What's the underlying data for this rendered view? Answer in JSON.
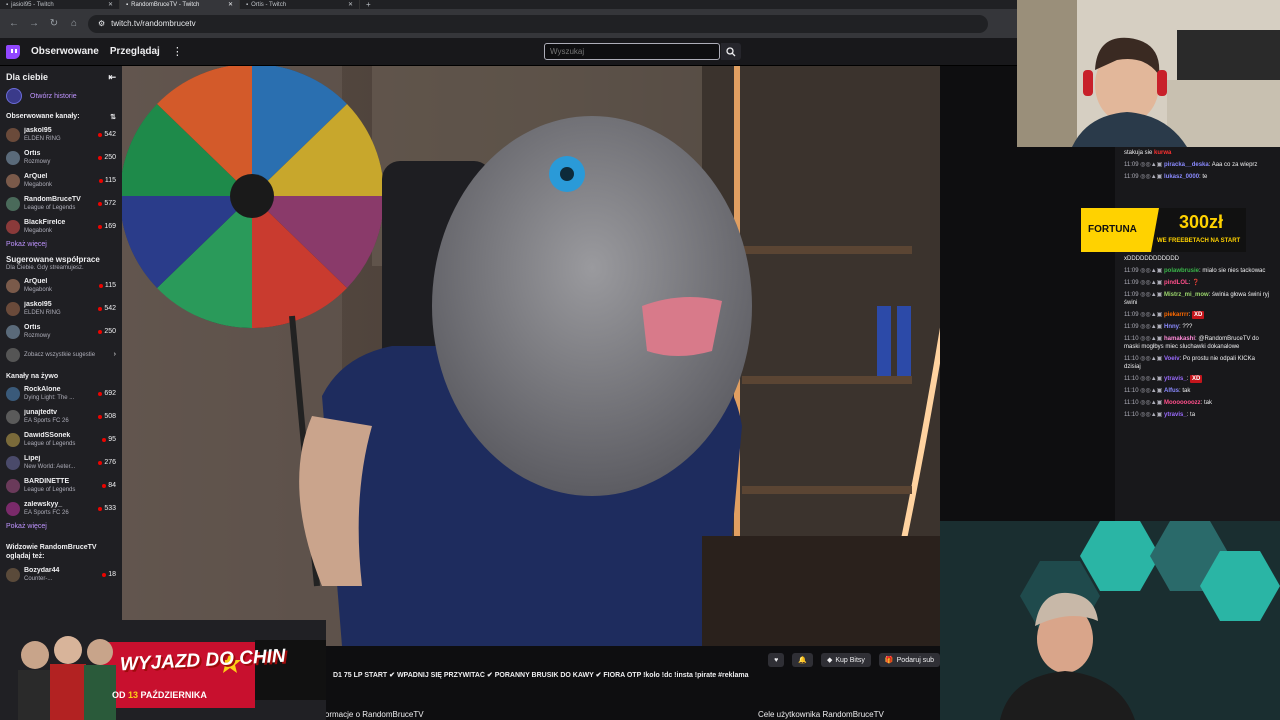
{
  "browser": {
    "tabs": [
      {
        "title": "jasiol95 - Twitch",
        "active": false
      },
      {
        "title": "RandomBruceTV - Twitch",
        "active": true
      },
      {
        "title": "Ortis - Twitch",
        "active": false
      }
    ],
    "new_tab": "+",
    "url": "twitch.tv/randombrucetv"
  },
  "topnav": {
    "followed": "Obserwowane",
    "browse": "Przeglądaj",
    "search_placeholder": "Wyszukaj"
  },
  "sidebar": {
    "title": "Dla ciebie",
    "history": "Otwórz historie",
    "followed_title": "Obserwowane kanały:",
    "followed": [
      {
        "name": "jaskol95",
        "game": "ELDEN RING",
        "viewers": "542",
        "color": "#6a4a3a"
      },
      {
        "name": "Ortis",
        "game": "Rozmowy",
        "viewers": "250",
        "color": "#5a6a7a"
      },
      {
        "name": "ArQuel",
        "game": "Megabonk",
        "viewers": "115",
        "color": "#7a5a4a"
      },
      {
        "name": "RandomBruceTV",
        "game": "League of Legends",
        "viewers": "572",
        "color": "#4a6a5a"
      },
      {
        "name": "BlackFireIce",
        "game": "Megabonk",
        "viewers": "169",
        "color": "#8a3a3a"
      }
    ],
    "show_more_1": "Pokaż więcej",
    "suggested_title": "Sugerowane współprace",
    "suggested_sub": "Dla Ciebie. Gdy streamujesz.",
    "suggested": [
      {
        "name": "ArQuel",
        "game": "Megabonk",
        "viewers": "115",
        "color": "#7a5a4a"
      },
      {
        "name": "jaskol95",
        "game": "ELDEN RING",
        "viewers": "542",
        "color": "#6a4a3a"
      },
      {
        "name": "Ortis",
        "game": "Rozmowy",
        "viewers": "250",
        "color": "#5a6a7a"
      }
    ],
    "see_all": "Zobacz wszystkie sugestie",
    "live_title": "Kanały na żywo",
    "live": [
      {
        "name": "RockAlone",
        "game": "Dying Light: The ...",
        "viewers": "692",
        "color": "#3a5a7a"
      },
      {
        "name": "junajtedtv",
        "game": "EA Sports FC 26",
        "viewers": "508",
        "color": "#5a5a5a"
      },
      {
        "name": "DawidSSonek",
        "game": "League of Legends",
        "viewers": "95",
        "color": "#7a6a3a"
      },
      {
        "name": "Lipej",
        "game": "New World: Aeter...",
        "viewers": "276",
        "color": "#4a4a6a"
      },
      {
        "name": "BARDINETTE",
        "game": "League of Legends",
        "viewers": "84",
        "color": "#6a3a5a"
      },
      {
        "name": "zalewskyy_",
        "game": "EA Sports FC 26",
        "viewers": "533",
        "color": "#7a2a6a"
      }
    ],
    "show_more_2": "Pokaż więcej",
    "watched_title": "Widzowie RandomBruceTV oglądaj też:",
    "watched": [
      {
        "name": "Bozydar44",
        "game": "Counter-...",
        "viewers": "18",
        "color": "#5a4a3a"
      }
    ]
  },
  "player_bar": {
    "buy_bits": "Kup Bitsy",
    "gift_sub": "Podaruj sub"
  },
  "stream_title": "D1 75 LP START ✔ WPADNIJ SIĘ PRZYWITAĆ ✔ PORANNY BRUSIK DO KAWY ✔ FIORA OTP !kolo !dc !insta !pirate #reklama",
  "about_left": "Informacje o RandomBruceTV",
  "about_right": "Cele użytkownika RandomBruceTV",
  "ad": {
    "title": "WYJAZD DO CHIN",
    "date_prefix": "OD",
    "date_day": "13",
    "date_month": "PAŹDZIERNIKA"
  },
  "chat_banner": {
    "brand": "FORTUNA",
    "amount": "300zł",
    "tagline": "WE FREEBETACH NA START"
  },
  "chat": [
    {
      "time": "",
      "user": "",
      "color": "#efeff1",
      "text": "stakuja sie",
      "emote": "kurwa"
    },
    {
      "time": "11:09",
      "user": "piracka__deska",
      "color": "#8a8aff",
      "text": "Aaa co za wieprz"
    },
    {
      "time": "11:09",
      "user": "lukasz_0000",
      "color": "#8a8aff",
      "text": "te"
    },
    {
      "time": "",
      "user": "",
      "color": "#efeff1",
      "text": "xDDDDDDDDDDDD"
    },
    {
      "time": "11:09",
      "user": "polawbrusie",
      "color": "#3ab54a",
      "text": "mialo sie nies tackowac"
    },
    {
      "time": "11:09",
      "user": "pindLOL",
      "color": "#ff4f8b",
      "text": "❓"
    },
    {
      "time": "11:09",
      "user": "Mistrz_mi_mow",
      "color": "#9ad46b",
      "text": "świnia głowa świni ryj świni"
    },
    {
      "time": "11:09",
      "user": "piekarrrr",
      "color": "#ff6a00",
      "text": "",
      "badge": "XD"
    },
    {
      "time": "11:09",
      "user": "Hnny",
      "color": "#8a8aff",
      "text": "???"
    },
    {
      "time": "11:10",
      "user": "hamakashi",
      "color": "#ff8ad8",
      "text": "@RandomBruceTV do maski mogłbys miec sluchawki dokanalowe"
    },
    {
      "time": "11:10",
      "user": "Voeiv",
      "color": "#9b6bff",
      "text": "Po prostu nie odpali KICKa dzisiaj"
    },
    {
      "time": "11:10",
      "user": "ytravis_",
      "color": "#9b6bff",
      "text": "",
      "badge": "XD"
    },
    {
      "time": "11:10",
      "user": "Alfus",
      "color": "#8a8aff",
      "text": "tak"
    },
    {
      "time": "11:10",
      "user": "Mooooooozz",
      "color": "#ff4f8b",
      "text": "tak"
    },
    {
      "time": "11:10",
      "user": "ytravis_",
      "color": "#9b6bff",
      "text": "ta"
    }
  ]
}
